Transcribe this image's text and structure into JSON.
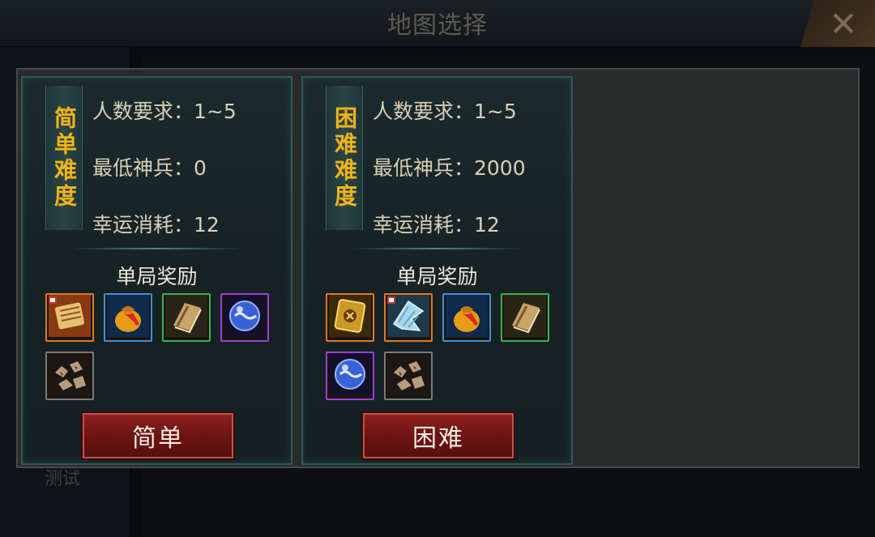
{
  "header": {
    "title": "地图选择",
    "close_icon": "✕"
  },
  "background": {
    "sidebar_label": "测试"
  },
  "cards": [
    {
      "tag_chars": [
        "简",
        "单",
        "难",
        "度"
      ],
      "players_label": "人数要求：1~5",
      "min_weapon_label": "最低神兵：0",
      "luck_cost_label": "幸运消耗：12",
      "reward_title": "单局奖励",
      "rewards": [
        {
          "name": "scroll-bundle-icon",
          "rarity": "orange",
          "locked": true
        },
        {
          "name": "money-bag-icon",
          "rarity": "blue",
          "locked": false
        },
        {
          "name": "book-icon",
          "rarity": "green",
          "locked": false
        },
        {
          "name": "blue-orb-icon",
          "rarity": "purple",
          "locked": false
        },
        {
          "name": "ore-icon",
          "rarity": "grey",
          "locked": false
        }
      ],
      "button_label": "简单"
    },
    {
      "tag_chars": [
        "困",
        "难",
        "难",
        "度"
      ],
      "players_label": "人数要求：1~5",
      "min_weapon_label": "最低神兵：2000",
      "luck_cost_label": "幸运消耗：12",
      "reward_title": "单局奖励",
      "rewards": [
        {
          "name": "golden-relic-icon",
          "rarity": "orange",
          "locked": false
        },
        {
          "name": "crystal-wing-icon",
          "rarity": "orange",
          "locked": true
        },
        {
          "name": "money-bag-icon",
          "rarity": "blue",
          "locked": false
        },
        {
          "name": "book-icon",
          "rarity": "green",
          "locked": false
        },
        {
          "name": "blue-orb-icon",
          "rarity": "purple",
          "locked": false
        },
        {
          "name": "ore-icon",
          "rarity": "grey",
          "locked": false
        }
      ],
      "button_label": "困难"
    }
  ],
  "colors": {
    "tag_text": "#f2b416",
    "button_bg": "#8e1f1d",
    "card_border": "#2f5a5a"
  }
}
